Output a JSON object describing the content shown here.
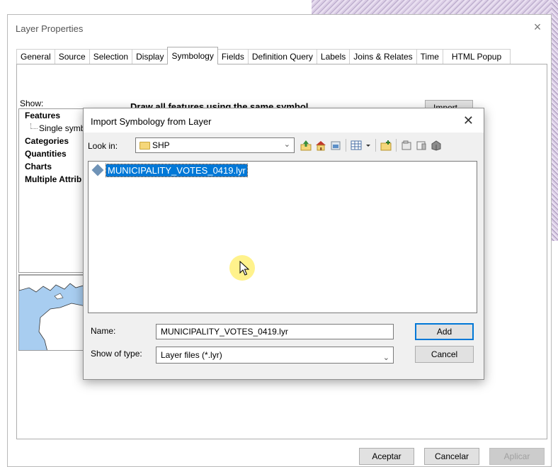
{
  "window": {
    "title": "Layer Properties",
    "close_glyph": "×",
    "tabs": [
      {
        "label": "General",
        "active": false
      },
      {
        "label": "Source",
        "active": false
      },
      {
        "label": "Selection",
        "active": false
      },
      {
        "label": "Display",
        "active": false
      },
      {
        "label": "Symbology",
        "active": true
      },
      {
        "label": "Fields",
        "active": false
      },
      {
        "label": "Definition Query",
        "active": false
      },
      {
        "label": "Labels",
        "active": false
      },
      {
        "label": "Joins & Relates",
        "active": false
      },
      {
        "label": "Time",
        "active": false
      },
      {
        "label": "HTML Popup",
        "active": false
      }
    ]
  },
  "symbology": {
    "show_label": "Show:",
    "show_items": [
      {
        "label": "Features"
      },
      {
        "label": "Single symb"
      },
      {
        "label": "Categories"
      },
      {
        "label": "Quantities"
      },
      {
        "label": "Charts"
      },
      {
        "label": "Multiple Attrib"
      }
    ],
    "heading": "Draw all features using the same symbol",
    "import_label": "Import..."
  },
  "footer": {
    "ok": "Aceptar",
    "cancel": "Cancelar",
    "apply": "Aplicar"
  },
  "dialog": {
    "title": "Import Symbology from Layer",
    "close_glyph": "✕",
    "look_in_label": "Look in:",
    "look_in_value": "SHP",
    "files": [
      {
        "name": "MUNICIPALITY_VOTES_0419.lyr",
        "selected": true
      }
    ],
    "name_label": "Name:",
    "name_value": "MUNICIPALITY_VOTES_0419.lyr",
    "type_label": "Show of type:",
    "type_value": "Layer files (*.lyr)",
    "add_label": "Add",
    "cancel_label": "Cancel"
  },
  "colors": {
    "selection": "#0078d7",
    "cursor_highlight": "#fff078"
  }
}
